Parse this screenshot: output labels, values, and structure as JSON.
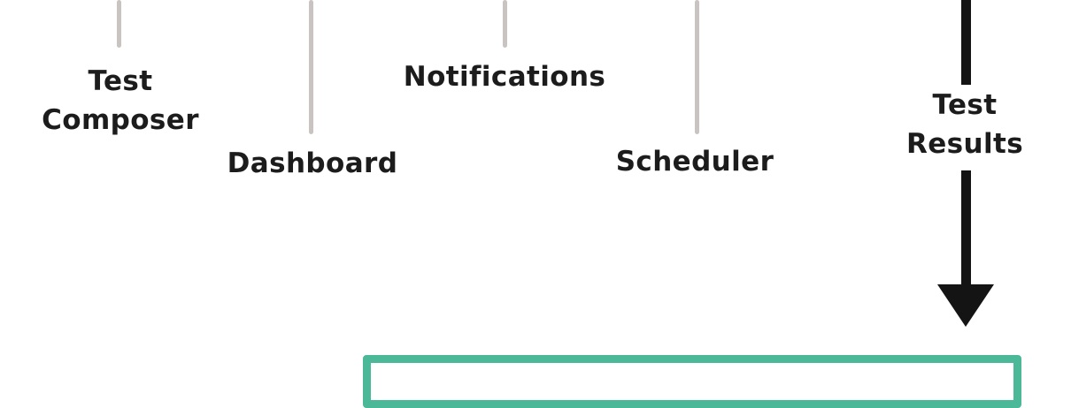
{
  "labels": {
    "test_composer": [
      "Test",
      "Composer"
    ],
    "dashboard": "Dashboard",
    "notifications": "Notifications",
    "scheduler": "Scheduler",
    "test_results": [
      "Test",
      "Results"
    ]
  },
  "colors": {
    "connector": "#c9c4c2",
    "main_line": "#141414",
    "text": "#1c1c1c",
    "box_border": "#4bb897",
    "background": "#ffffff"
  }
}
